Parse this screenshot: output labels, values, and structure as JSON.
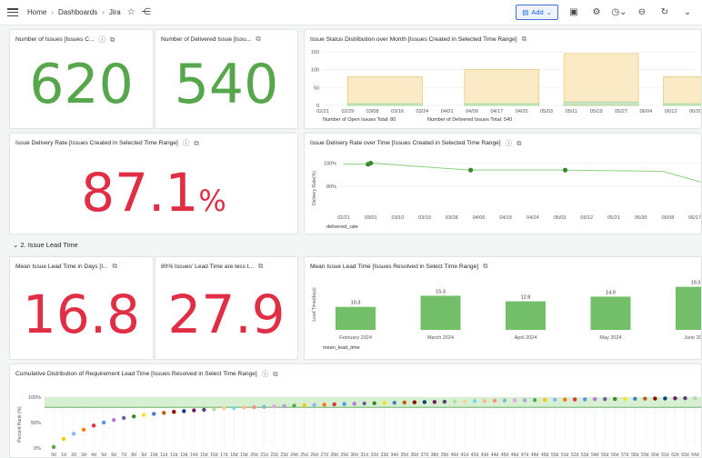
{
  "breadcrumb": {
    "home": "Home",
    "dashboards": "Dashboards",
    "current": "Jira"
  },
  "toolbar": {
    "add_label": "Add"
  },
  "stats": {
    "issues": {
      "title": "Number of Issues [Issues C...",
      "value": "620"
    },
    "delivered": {
      "title": "Number of Delivered Issue [Issu...",
      "value": "540"
    },
    "rate": {
      "title": "Issue Delivery Rate [Issues Created in Selected Time Range]",
      "value": "87.1",
      "unit": "%"
    },
    "mean_lead": {
      "title": "Mean Issue Lead Time in Days [I...",
      "value": "16.8"
    },
    "p80_lead": {
      "title": "80% Issues' Lead Time are less t...",
      "value": "27.9"
    }
  },
  "section": {
    "label": "⌄ 2. Issue Lead Time"
  },
  "colors": {
    "green": "#56a64b",
    "red": "#e02f44",
    "bar_yellow": "#fbeac6",
    "bar_green": "#73bf69",
    "scatter_band": "#d7f0d2"
  },
  "status_chart": {
    "title": "Issue Status Distribution over Month [Issues Created in Selected Time Range]",
    "legend": [
      "Number of Open Issues  Total: 80",
      "Number of Delivered Issues  Total: 540"
    ]
  },
  "rate_chart": {
    "title": "Issue Delivery Rate over Time [Issues Created in Selected Time Range]",
    "ylabel": "Delivery Rate(%)",
    "legend": "delivered_rate"
  },
  "lead_chart": {
    "title": "Mean Issue Lead Time [Issues Resolved in Select Time Range]",
    "ylabel": "Lead Time(days)",
    "legend": "mean_lead_time"
  },
  "cdf_chart": {
    "title": "Cumulative Distribution of Requirement Lead Time [Issues Resolved in Select Time Range]",
    "ylabel": "Percent Rank (%)"
  },
  "chart_data": [
    {
      "id": "status",
      "type": "bar",
      "x_ticks": [
        "02/21",
        "02/29",
        "03/08",
        "03/16",
        "03/24",
        "04/01",
        "04/09",
        "04/17",
        "04/25",
        "05/03",
        "05/11",
        "05/19",
        "05/27",
        "06/04",
        "06/12",
        "06/20"
      ],
      "y_ticks": [
        0,
        50,
        100,
        150
      ],
      "ylim": [
        0,
        160
      ],
      "bars": [
        {
          "start": 1,
          "end": 4,
          "open": 5,
          "delivered": 80
        },
        {
          "start": 5.7,
          "end": 8.7,
          "open": 5,
          "delivered": 100
        },
        {
          "start": 9.7,
          "end": 12.7,
          "open": 10,
          "delivered": 145
        },
        {
          "start": 13.7,
          "end": 15.7,
          "open": 5,
          "delivered": 80
        }
      ]
    },
    {
      "id": "rate",
      "type": "line",
      "x_ticks": [
        "02/21",
        "03/01",
        "03/10",
        "03/19",
        "03/28",
        "04/06",
        "04/15",
        "04/24",
        "05/03",
        "05/12",
        "05/21",
        "05/30",
        "06/08",
        "06/17"
      ],
      "y_ticks": [
        "100%",
        "80%"
      ],
      "ylim": [
        60,
        105
      ],
      "points": [
        {
          "x": 0,
          "y": 99
        },
        {
          "x": 0.9,
          "y": 99
        },
        {
          "x": 1,
          "y": 100
        },
        {
          "x": 4.7,
          "y": 94
        },
        {
          "x": 8.2,
          "y": 94
        },
        {
          "x": 11.8,
          "y": 93
        },
        {
          "x": 13.5,
          "y": 82
        }
      ],
      "markers": [
        1,
        2,
        3,
        4
      ]
    },
    {
      "id": "lead",
      "type": "bar",
      "categories": [
        "February 2024",
        "March 2024",
        "April 2024",
        "May 2024",
        "June 2024"
      ],
      "values": [
        10.3,
        15.3,
        12.8,
        14.9,
        19.3
      ],
      "ylim": [
        0,
        22
      ]
    },
    {
      "id": "cdf",
      "type": "scatter",
      "x_ticks": [
        "0d",
        "1d",
        "2d",
        "3d",
        "4d",
        "5d",
        "6d",
        "7d",
        "8d",
        "9d",
        "10d",
        "11d",
        "12d",
        "13d",
        "14d",
        "15d",
        "16d",
        "17d",
        "18d",
        "19d",
        "20d",
        "21d",
        "22d",
        "23d",
        "24d",
        "25d",
        "26d",
        "27d",
        "28d",
        "29d",
        "30d",
        "31d",
        "32d",
        "33d",
        "34d",
        "35d",
        "36d",
        "37d",
        "38d",
        "39d",
        "40d",
        "41d",
        "42d",
        "43d",
        "44d",
        "45d",
        "46d",
        "47d",
        "48d",
        "49d",
        "50d",
        "51d",
        "52d",
        "53d",
        "54d",
        "55d",
        "56d",
        "57d",
        "58d",
        "59d",
        "60d",
        "61d",
        "62d",
        "63d",
        "64d",
        "65d"
      ],
      "y_ticks": [
        "0%",
        "50%",
        "100%"
      ],
      "ylim": [
        0,
        100
      ],
      "points": [
        2,
        18,
        28,
        36,
        44,
        50,
        55,
        59,
        62,
        65,
        67,
        69,
        71,
        72.5,
        74,
        75,
        76.5,
        77.5,
        78.5,
        79.5,
        80.3,
        81,
        81.8,
        82.5,
        83.2,
        84,
        84.6,
        85.2,
        85.8,
        86.4,
        87,
        87.5,
        88,
        88.5,
        89,
        89.4,
        89.8,
        90.2,
        90.6,
        91,
        91.4,
        91.8,
        92.2,
        92.6,
        93,
        93.3,
        93.6,
        93.9,
        94.2,
        94.5,
        94.8,
        95.1,
        95.4,
        95.7,
        96,
        96.2,
        96.4,
        96.6,
        96.8,
        97,
        97.2,
        97.4,
        97.6,
        97.8,
        98,
        98.2
      ],
      "palette": [
        "#56a64b",
        "#f2cc0c",
        "#8ab8ff",
        "#ff780a",
        "#e02f44",
        "#5794f2",
        "#b877d9",
        "#705da0",
        "#37872d",
        "#fade2a",
        "#447ebc",
        "#c15c17",
        "#890f02",
        "#0a437c",
        "#6d1f62",
        "#584477",
        "#b7dbab",
        "#f4d598",
        "#70dbed",
        "#f9ba8f",
        "#f29191",
        "#82b5d8",
        "#e5a8e2",
        "#aea2e0"
      ]
    }
  ]
}
